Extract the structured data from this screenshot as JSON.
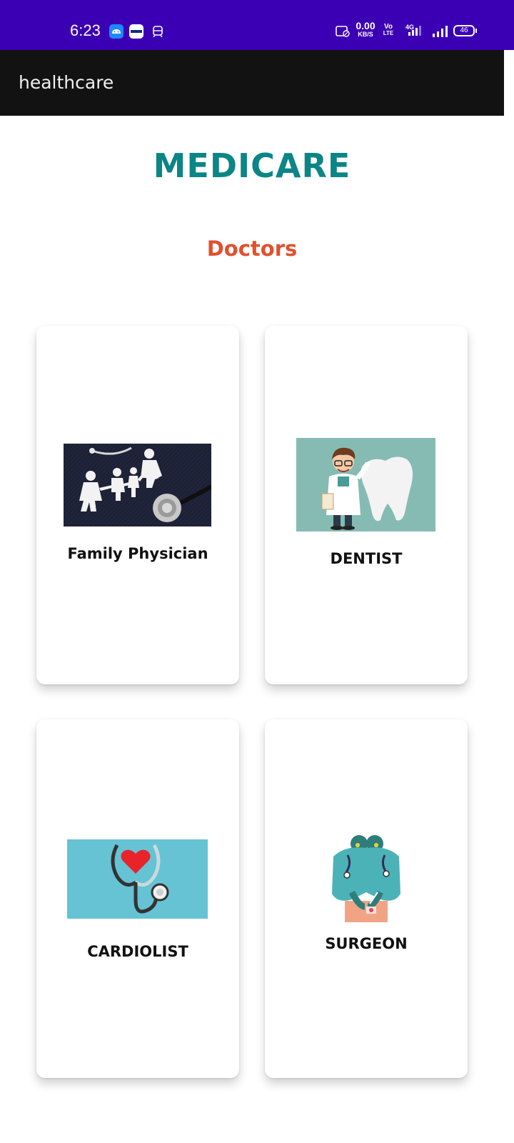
{
  "status_bar": {
    "time": "6:23",
    "speed_value": "0.00",
    "speed_unit": "KB/S",
    "volte_top": "Vo",
    "volte_bottom": "LTE",
    "network": "4G",
    "battery": "46",
    "background_color": "#3c00b4",
    "icons": [
      "android-icon",
      "paytm-icon",
      "train-icon",
      "data-saver-icon",
      "volte-icon",
      "signal-icon",
      "battery-icon"
    ]
  },
  "app_bar": {
    "title": "healthcare",
    "background_color": "#121212"
  },
  "main": {
    "title": "MEDICARE",
    "title_color": "#0b8585",
    "subtitle": "Doctors",
    "subtitle_color": "#e1502e",
    "cards": [
      {
        "label": "Family Physician",
        "image": "family-stethoscope-image"
      },
      {
        "label": "DENTIST",
        "image": "dentist-tooth-image"
      },
      {
        "label": "CARDIOLIST",
        "image": "heart-stethoscope-image"
      },
      {
        "label": "SURGEON",
        "image": "surgeons-image"
      }
    ]
  }
}
